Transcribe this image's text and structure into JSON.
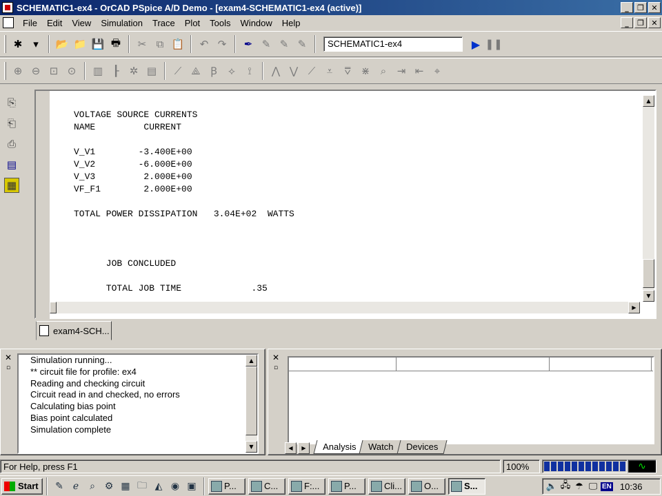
{
  "window": {
    "title": "SCHEMATIC1-ex4 - OrCAD PSpice A/D Demo  - [exam4-SCHEMATIC1-ex4 (active)]",
    "minimize": "_",
    "restore": "❐",
    "close": "✕"
  },
  "menu": {
    "items": [
      "File",
      "Edit",
      "View",
      "Simulation",
      "Trace",
      "Plot",
      "Tools",
      "Window",
      "Help"
    ]
  },
  "toolbar": {
    "profile_value": "SCHEMATIC1-ex4",
    "run_glyph": "▶",
    "pause_glyph": "❚❚"
  },
  "output": {
    "lines": [
      "VOLTAGE SOURCE CURRENTS",
      "NAME         CURRENT",
      "",
      "V_V1        -3.400E+00",
      "V_V2        -6.000E+00",
      "V_V3         2.000E+00",
      "VF_F1        2.000E+00",
      "",
      "TOTAL POWER DISSIPATION   3.04E+02  WATTS",
      "",
      "",
      "",
      "      JOB CONCLUDED",
      "",
      "      TOTAL JOB TIME             .35"
    ]
  },
  "doc_tab": {
    "label": "exam4-SCH..."
  },
  "sim_log": {
    "close_glyph": "✕",
    "lines": [
      "Simulation running...",
      "** circuit file for profile: ex4",
      "Reading and checking circuit",
      "Circuit read in and checked, no errors",
      "Calculating bias point",
      "Bias point calculated",
      "Simulation complete"
    ]
  },
  "watch": {
    "close_glyph": "✕",
    "tabs": [
      "Analysis",
      "Watch",
      "Devices"
    ]
  },
  "status": {
    "help": "For Help, press F1",
    "zoom": "100%",
    "progress_fraction": 1.0
  },
  "taskbar": {
    "start": "Start",
    "buttons": [
      "P...",
      "C...",
      "F:...",
      "P...",
      "Cli...",
      "O...",
      "S..."
    ],
    "lang": "EN",
    "clock": "10:36"
  }
}
